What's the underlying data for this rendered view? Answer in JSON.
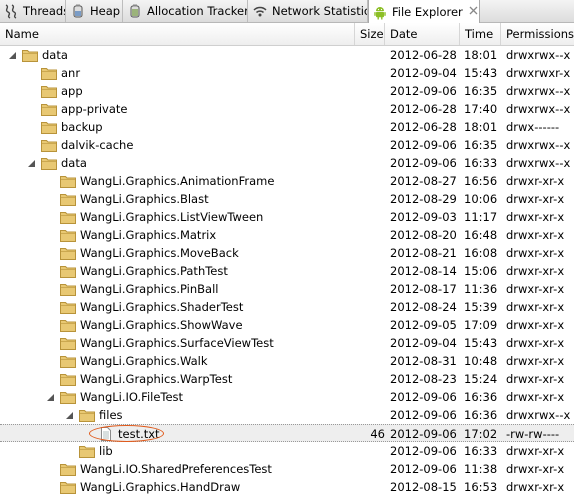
{
  "tabs": [
    {
      "label": "Threads",
      "icon": "threads-icon"
    },
    {
      "label": "Heap",
      "icon": "heap-icon"
    },
    {
      "label": "Allocation Tracker",
      "icon": "allocation-tracker-icon"
    },
    {
      "label": "Network Statistics",
      "icon": "network-statistics-icon"
    },
    {
      "label": "File Explorer",
      "icon": "android-icon",
      "active": true,
      "close_icon": "close-icon"
    }
  ],
  "columns": {
    "name": "Name",
    "size": "Size",
    "date": "Date",
    "time": "Time",
    "permissions": "Permissions"
  },
  "rows": [
    {
      "name": "data",
      "level": 0,
      "type": "folder",
      "expanded": true,
      "size": "",
      "date": "2012-06-28",
      "time": "18:01",
      "perm": "drwxrwx--x"
    },
    {
      "name": "anr",
      "level": 1,
      "type": "folder",
      "size": "",
      "date": "2012-09-04",
      "time": "15:43",
      "perm": "drwxrwxr-x"
    },
    {
      "name": "app",
      "level": 1,
      "type": "folder",
      "size": "",
      "date": "2012-09-06",
      "time": "16:35",
      "perm": "drwxrwx--x"
    },
    {
      "name": "app-private",
      "level": 1,
      "type": "folder",
      "size": "",
      "date": "2012-06-28",
      "time": "17:40",
      "perm": "drwxrwx--x"
    },
    {
      "name": "backup",
      "level": 1,
      "type": "folder",
      "size": "",
      "date": "2012-06-28",
      "time": "18:01",
      "perm": "drwx------"
    },
    {
      "name": "dalvik-cache",
      "level": 1,
      "type": "folder",
      "size": "",
      "date": "2012-09-06",
      "time": "16:35",
      "perm": "drwxrwx--x"
    },
    {
      "name": "data",
      "level": 1,
      "type": "folder",
      "expanded": true,
      "size": "",
      "date": "2012-09-06",
      "time": "16:33",
      "perm": "drwxrwx--x"
    },
    {
      "name": "WangLi.Graphics.AnimationFrame",
      "level": 2,
      "type": "folder",
      "size": "",
      "date": "2012-08-27",
      "time": "16:56",
      "perm": "drwxr-xr-x"
    },
    {
      "name": "WangLi.Graphics.Blast",
      "level": 2,
      "type": "folder",
      "size": "",
      "date": "2012-08-29",
      "time": "10:06",
      "perm": "drwxr-xr-x"
    },
    {
      "name": "WangLi.Graphics.ListViewTween",
      "level": 2,
      "type": "folder",
      "size": "",
      "date": "2012-09-03",
      "time": "11:17",
      "perm": "drwxr-xr-x"
    },
    {
      "name": "WangLi.Graphics.Matrix",
      "level": 2,
      "type": "folder",
      "size": "",
      "date": "2012-08-20",
      "time": "16:48",
      "perm": "drwxr-xr-x"
    },
    {
      "name": "WangLi.Graphics.MoveBack",
      "level": 2,
      "type": "folder",
      "size": "",
      "date": "2012-08-21",
      "time": "16:08",
      "perm": "drwxr-xr-x"
    },
    {
      "name": "WangLi.Graphics.PathTest",
      "level": 2,
      "type": "folder",
      "size": "",
      "date": "2012-08-14",
      "time": "15:06",
      "perm": "drwxr-xr-x"
    },
    {
      "name": "WangLi.Graphics.PinBall",
      "level": 2,
      "type": "folder",
      "size": "",
      "date": "2012-08-17",
      "time": "11:36",
      "perm": "drwxr-xr-x"
    },
    {
      "name": "WangLi.Graphics.ShaderTest",
      "level": 2,
      "type": "folder",
      "size": "",
      "date": "2012-08-24",
      "time": "15:39",
      "perm": "drwxr-xr-x"
    },
    {
      "name": "WangLi.Graphics.ShowWave",
      "level": 2,
      "type": "folder",
      "size": "",
      "date": "2012-09-05",
      "time": "17:09",
      "perm": "drwxr-xr-x"
    },
    {
      "name": "WangLi.Graphics.SurfaceViewTest",
      "level": 2,
      "type": "folder",
      "size": "",
      "date": "2012-09-04",
      "time": "15:43",
      "perm": "drwxr-xr-x"
    },
    {
      "name": "WangLi.Graphics.Walk",
      "level": 2,
      "type": "folder",
      "size": "",
      "date": "2012-08-31",
      "time": "10:48",
      "perm": "drwxr-xr-x"
    },
    {
      "name": "WangLi.Graphics.WarpTest",
      "level": 2,
      "type": "folder",
      "size": "",
      "date": "2012-08-23",
      "time": "15:24",
      "perm": "drwxr-xr-x"
    },
    {
      "name": "WangLi.IO.FileTest",
      "level": 2,
      "type": "folder",
      "expanded": true,
      "size": "",
      "date": "2012-09-06",
      "time": "16:36",
      "perm": "drwxr-xr-x"
    },
    {
      "name": "files",
      "level": 3,
      "type": "folder",
      "expanded": true,
      "size": "",
      "date": "2012-09-06",
      "time": "16:36",
      "perm": "drwxrwx--x"
    },
    {
      "name": "test.txt",
      "level": 4,
      "type": "file",
      "selected": true,
      "size": "46",
      "date": "2012-09-06",
      "time": "17:02",
      "perm": "-rw-rw----"
    },
    {
      "name": "lib",
      "level": 3,
      "type": "folder",
      "size": "",
      "date": "2012-09-06",
      "time": "16:33",
      "perm": "drwxr-xr-x"
    },
    {
      "name": "WangLi.IO.SharedPreferencesTest",
      "level": 2,
      "type": "folder",
      "size": "",
      "date": "2012-09-06",
      "time": "11:38",
      "perm": "drwxr-xr-x"
    },
    {
      "name": "WangLi.Graphics.HandDraw",
      "level": 2,
      "type": "folder",
      "size": "",
      "date": "2012-08-15",
      "time": "16:53",
      "perm": "drwxr-xr-x"
    }
  ],
  "colors": {
    "folder": "#e8c873",
    "folder_edge": "#b8933a",
    "android": "#8cbf26",
    "highlight_ring": "#e05a1b"
  }
}
